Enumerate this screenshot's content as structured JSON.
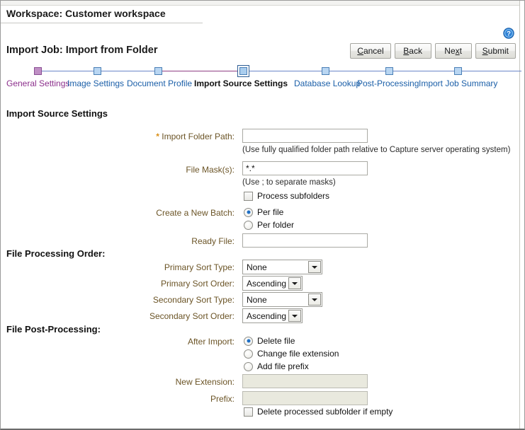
{
  "header": {
    "workspace_title": "Workspace: Customer workspace",
    "job_title": "Import Job: Import from Folder",
    "help_icon": "help-question-icon"
  },
  "toolbar": {
    "buttons": [
      {
        "label": "Cancel",
        "mnemonic": "C",
        "rest": "ancel"
      },
      {
        "label": "Back",
        "mnemonic": "B",
        "rest": "ack"
      },
      {
        "label": "Next",
        "pre": "Ne",
        "mnemonic": "x",
        "rest": "t"
      },
      {
        "label": "Submit",
        "mnemonic": "S",
        "rest": "ubmit"
      }
    ]
  },
  "wizard": {
    "steps": [
      {
        "label": "General Settings",
        "state": "visited"
      },
      {
        "label": "Image Settings",
        "state": "todo"
      },
      {
        "label": "Document Profile",
        "state": "todo"
      },
      {
        "label": "Import Source Settings",
        "state": "current"
      },
      {
        "label": "Database Lookup",
        "state": "todo"
      },
      {
        "label": "Post-Processing",
        "state": "todo"
      },
      {
        "label": "Import Job Summary",
        "state": "todo"
      }
    ]
  },
  "sections": {
    "main_heading": "Import Source Settings",
    "file_processing_order": "File Processing Order:",
    "file_post_processing": "File Post-Processing:"
  },
  "fields": {
    "import_folder_path": {
      "label": "Import Folder Path:",
      "required_marker": "*",
      "value": "",
      "hint": "(Use fully qualified folder path relative to Capture server operating system)"
    },
    "file_masks": {
      "label": "File Mask(s):",
      "value": "*.*",
      "hint": "(Use ; to separate masks)"
    },
    "process_subfolders": {
      "label": "Process subfolders",
      "checked": false
    },
    "create_new_batch": {
      "label": "Create a New Batch:",
      "options": [
        {
          "label": "Per file",
          "selected": true
        },
        {
          "label": "Per folder",
          "selected": false
        }
      ]
    },
    "ready_file": {
      "label": "Ready File:",
      "value": ""
    },
    "primary_sort_type": {
      "label": "Primary Sort Type:",
      "value": "None"
    },
    "primary_sort_order": {
      "label": "Primary Sort Order:",
      "value": "Ascending"
    },
    "secondary_sort_type": {
      "label": "Secondary Sort Type:",
      "value": "None"
    },
    "secondary_sort_order": {
      "label": "Secondary Sort Order:",
      "value": "Ascending"
    },
    "after_import": {
      "label": "After Import:",
      "options": [
        {
          "label": "Delete file",
          "selected": true
        },
        {
          "label": "Change file extension",
          "selected": false
        },
        {
          "label": "Add file prefix",
          "selected": false
        }
      ]
    },
    "new_extension": {
      "label": "New Extension:",
      "value": "",
      "disabled": true
    },
    "prefix": {
      "label": "Prefix:",
      "value": "",
      "disabled": true
    },
    "delete_processed_subfolder": {
      "label": "Delete processed subfolder if empty",
      "checked": false
    }
  },
  "colors": {
    "label_brown": "#6b5426",
    "required_orange": "#d98f16",
    "link_blue": "#1b5fa8",
    "visited_purple": "#8c2f8c",
    "accent_blue": "#2c5d94"
  }
}
